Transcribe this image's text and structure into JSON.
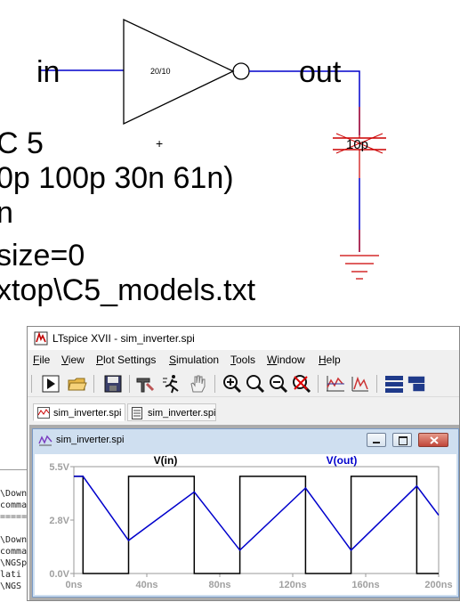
{
  "schematic": {
    "label_in": "in",
    "label_out": "out",
    "inverter_label": "20/10",
    "cap_value": "10p",
    "directive_lines": [
      "C 5",
      "0p 100p 30n 61n)",
      "n",
      "size=0",
      "xtop\\C5_models.txt"
    ]
  },
  "background_window": {
    "lines": [
      "\\Down",
      "comma",
      "=====",
      "\\Down",
      "comma",
      "\\NGSp",
      "lati",
      "\\NGS"
    ]
  },
  "app": {
    "title": "LTspice XVII - sim_inverter.spi",
    "menu": [
      "File",
      "View",
      "Plot Settings",
      "Simulation",
      "Tools",
      "Window",
      "Help"
    ],
    "toolbar_icons": [
      "run-icon",
      "open-icon",
      "save-icon",
      "control-panel-icon",
      "halt-icon",
      "pan-icon",
      "zoom-in-icon",
      "zoom-area-icon",
      "zoom-out-icon",
      "zoom-cancel-icon",
      "autorange-icon",
      "fft-icon",
      "tile-horizontal-icon",
      "tile-vertical-icon"
    ],
    "tabs": [
      {
        "label": "sim_inverter.spi",
        "icon": "waveform-icon"
      },
      {
        "label": "sim_inverter.spi",
        "icon": "netlist-icon"
      }
    ],
    "plot_window_title": "sim_inverter.spi",
    "colors": {
      "vin": "#000000",
      "vout": "#0000cc",
      "axis_text": "#a0a0a0",
      "wire": "#0000cc",
      "component": "#cc0000"
    }
  },
  "chart_data": {
    "type": "line",
    "x_unit": "ns",
    "y_unit": "V",
    "xlim": [
      0,
      200
    ],
    "ylim": [
      0,
      5.5
    ],
    "x_ticks": [
      "0ns",
      "40ns",
      "80ns",
      "120ns",
      "160ns",
      "200ns"
    ],
    "y_ticks": [
      "0.0V",
      "2.8V",
      "5.5V"
    ],
    "grid": false,
    "legend_placement": "top",
    "series": [
      {
        "name": "V(in)",
        "color": "#000000",
        "x": [
          0,
          5,
          5,
          30,
          30,
          66,
          66,
          91,
          91,
          127,
          127,
          152,
          152,
          188,
          188,
          200
        ],
        "y": [
          5.0,
          5.0,
          0.0,
          0.0,
          5.0,
          5.0,
          0.0,
          0.0,
          5.0,
          5.0,
          0.0,
          0.0,
          5.0,
          5.0,
          0.0,
          0.0
        ]
      },
      {
        "name": "V(out)",
        "color": "#0000cc",
        "x": [
          0,
          5,
          30,
          66,
          91,
          127,
          152,
          188,
          200
        ],
        "y": [
          5.0,
          5.0,
          1.7,
          4.2,
          1.2,
          4.4,
          1.2,
          4.5,
          3.0
        ]
      }
    ]
  }
}
